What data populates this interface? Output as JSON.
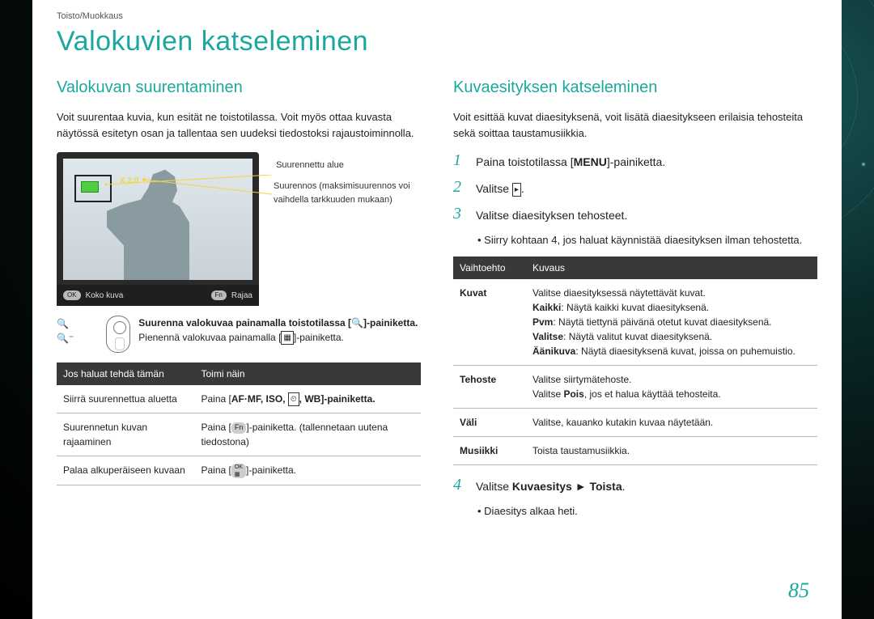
{
  "breadcrumb": "Toisto/Muokkaus",
  "title": "Valokuvien katseleminen",
  "left": {
    "heading": "Valokuvan suurentaminen",
    "intro": "Voit suurentaa kuvia, kun esität ne toistotilassa. Voit myös ottaa kuvasta näytössä esitetyn osan ja tallentaa sen uudeksi tiedostoksi rajaustoiminnolla.",
    "zoom_label": "X 2.0",
    "callout1": "Suurennettu alue",
    "callout2": "Suurennos (maksimisuurennos voi vaihdella tarkkuuden mukaan)",
    "footer_left_pill": "OK",
    "footer_left_text": "Koko kuva",
    "footer_right_pill": "Fn",
    "footer_right_text": "Rajaa",
    "zoom_instr_bold": "Suurenna valokuvaa painamalla toistotilassa [",
    "zoom_instr_bold2": "]-painiketta.",
    "zoom_instr2a": "Pienennä valokuvaa painamalla [",
    "zoom_instr2b": "]-painiketta.",
    "table": {
      "h1": "Jos haluat tehdä tämän",
      "h2": "Toimi näin",
      "rows": [
        {
          "a": "Siirrä suurennettua aluetta",
          "b_prefix": "Paina [",
          "b_mid": "AF·MF, ISO, ",
          "b_suffix": ", WB]-painiketta."
        },
        {
          "a": "Suurennetun kuvan rajaaminen",
          "b_prefix": "Paina [",
          "b_pill": "Fn",
          "b_suffix": "]-painiketta. (tallennetaan uutena tiedostona)"
        },
        {
          "a": "Palaa alkuperäiseen kuvaan",
          "b_prefix": "Paina [",
          "b_pill": "OK",
          "b_suffix": "]-painiketta."
        }
      ]
    }
  },
  "right": {
    "heading": "Kuvaesityksen katseleminen",
    "intro": "Voit esittää kuvat diaesityksenä, voit lisätä diaesitykseen erilaisia tehosteita sekä soittaa taustamusiikkia.",
    "steps": {
      "s1a": "Paina toistotilassa [",
      "s1menu": "MENU",
      "s1b": "]-painiketta.",
      "s2a": "Valitse ",
      "s2b": ".",
      "s3": "Valitse diaesityksen tehosteet.",
      "s3_bullet": "Siirry kohtaan 4, jos haluat käynnistää diaesityksen ilman tehostetta.",
      "s4a": "Valitse ",
      "s4b": "Kuvaesitys ► Toista",
      "s4c": ".",
      "s4_bullet": "Diaesitys alkaa heti."
    },
    "table": {
      "h1": "Vaihtoehto",
      "h2": "Kuvaus",
      "rows": [
        {
          "a": "Kuvat",
          "b": "Valitse diaesityksessä näytettävät kuvat.\nKaikki: Näytä kaikki kuvat diaesityksenä.\nPvm: Näytä tiettynä päivänä otetut kuvat diaesityksenä.\nValitse: Näytä valitut kuvat diaesityksenä.\nÄänikuva: Näytä diaesityksenä kuvat, joissa on puhemuistio."
        },
        {
          "a": "Tehoste",
          "b": "Valitse siirtymätehoste.\nValitse Pois, jos et halua käyttää tehosteita."
        },
        {
          "a": "Väli",
          "b": "Valitse, kauanko kutakin kuvaa näytetään."
        },
        {
          "a": "Musiikki",
          "b": "Toista taustamusiikkia."
        }
      ]
    }
  },
  "page_number": "85"
}
